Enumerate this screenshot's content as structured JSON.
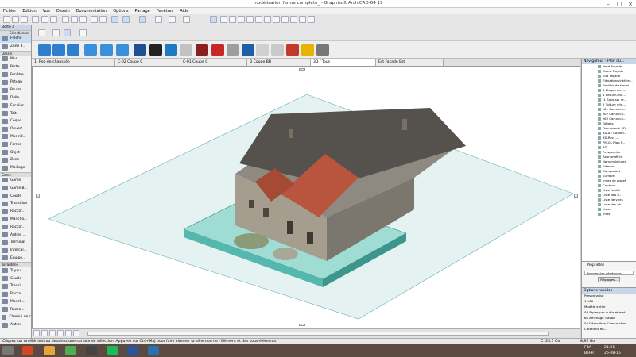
{
  "window": {
    "title": "modélisation ferme complete_ - Graphisoft ArchiCAD-64 19"
  },
  "menu": [
    "Fichier",
    "Edition",
    "Vue",
    "Dessin",
    "Documentation",
    "Options",
    "Partage",
    "Fenêtres",
    "Aide"
  ],
  "toolbox": {
    "header": "Boîte à",
    "select_label": "Sélectionner",
    "tools_select": [
      "Flèche",
      "Zone d..."
    ],
    "group_dessin": "Dessin",
    "tools_dessin": [
      "Mur",
      "Porte",
      "Fenêtre",
      "Poteau",
      "Poutre",
      "Dalle",
      "Escalier",
      "Toit",
      "Coque",
      "Ouvert...",
      "Mur-rid...",
      "Forme",
      "Objet",
      "Zone",
      "Maillage"
    ],
    "group_game": "Game",
    "tools_game": [
      "Game",
      "Game B...",
      "Coude",
      "Transition",
      "Raccor...",
      "Mancho...",
      "Raccor...",
      "Autres ...",
      "Terminal",
      "Intercal...",
      "Equipe..."
    ],
    "group_tuyau": "Tuyauterie",
    "tools_tuyau": [
      "Tuyau",
      "Coude",
      "Transi...",
      "Racco...",
      "Manch...",
      "Racco...",
      "Chemin de c",
      "Autres"
    ]
  },
  "tabs": [
    "1. Rez-de-chaussée",
    "C-02 Coupe C",
    "C-01 Coupe C",
    "B Coupe BB",
    "3D / Tous",
    "Est Façade Est"
  ],
  "navigator": {
    "title": "Navigateur - Plan du...",
    "items": [
      "Nord Façade...",
      "Ouest Façade",
      "Sud Façade",
      "Elévations intérie...",
      "Feuilles de travai...",
      "0 Etage relev...",
      "1 Rez-de-cha...",
      "-1 Sous-sol re...",
      "2 Toiture rele...",
      "z01 Cartouch...",
      "z02 Cartouch...",
      "z03 Cartouch...",
      "Détails",
      "Documents 3D",
      "3D-02 Docum...",
      "3D-Rez -...",
      "PM-01 Plan F...",
      "3D",
      "Perspective",
      "Axonométrie",
      "Nomenclatures",
      "Elément",
      "Composant",
      "Surface",
      "Index de projet",
      "Contenu",
      "Liste feuille",
      "Liste des d...",
      "Liste de vues",
      "Liste des ch...",
      "Listes",
      "Infos"
    ]
  },
  "properties": {
    "title": "Propriétés",
    "value": "Perspective générique",
    "button": "Réglages..."
  },
  "quick_options": {
    "title": "Options rapides",
    "items": [
      "Personnalisé",
      "1:100",
      "Modèle entier",
      "09 Styles par outils et mat...",
      "60 Affichage Travail",
      "04 Démolition Construction",
      "Cotations en..."
    ]
  },
  "status": "Cliquez sur un élément ou dessinez une surface de sélection. Appuyez sur Ctrl+Maj pour faire alterner la sélection de l'élément et des sous-éléments.",
  "view_status": {
    "left": "C: 25,7 Go",
    "right": "8,93 Go"
  },
  "taskbar": {
    "lang": "FRA",
    "layout": "BEFR",
    "time": "21:01",
    "date": "26-08-15"
  }
}
